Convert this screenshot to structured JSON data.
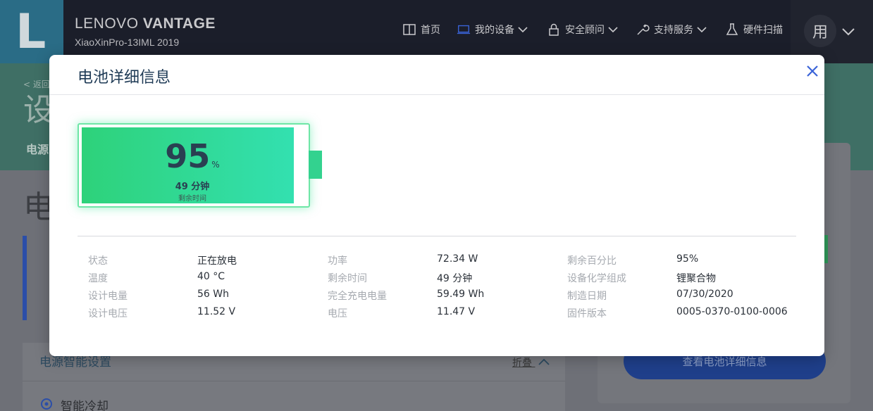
{
  "header": {
    "logo_letter": "L",
    "brand_light": "LENOVO",
    "brand_bold": "VANTAGE",
    "model": "XiaoXinPro-13IML 2019",
    "nav": [
      {
        "label": "首页",
        "icon": "book-icon"
      },
      {
        "label": "我的设备",
        "icon": "laptop-icon"
      },
      {
        "label": "安全顾问",
        "icon": "lock-icon"
      },
      {
        "label": "支持服务",
        "icon": "wrench-icon"
      },
      {
        "label": "硬件扫描",
        "icon": "flask-icon"
      }
    ],
    "avatar": "用"
  },
  "background": {
    "back_link": "< 返回",
    "hero_char": "设",
    "hero_tab": "电源",
    "section_char": "电",
    "left_card_title": "电源智能设置",
    "fold_label": "折叠",
    "cooling_label": "智能冷却",
    "view_details_button": "查看电池详细信息"
  },
  "modal": {
    "title": "电池详细信息",
    "battery": {
      "percent_value": "95",
      "percent_unit": "%",
      "fill_level": 95,
      "remaining_time": "49 分钟",
      "remaining_label": "剩余时间"
    },
    "specs": [
      [
        {
          "label": "状态",
          "value": "正在放电"
        },
        {
          "label": "功率",
          "value": "72.34 W"
        },
        {
          "label": "剩余百分比",
          "value": "95%"
        }
      ],
      [
        {
          "label": "温度",
          "value": "40 °C"
        },
        {
          "label": "剩余时间",
          "value": "49 分钟"
        },
        {
          "label": "设备化学组成",
          "value": "锂聚合物"
        }
      ],
      [
        {
          "label": "设计电量",
          "value": "56 Wh"
        },
        {
          "label": "完全充电电量",
          "value": "59.49 Wh"
        },
        {
          "label": "制造日期",
          "value": "07/30/2020"
        }
      ],
      [
        {
          "label": "设计电压",
          "value": "11.52 V"
        },
        {
          "label": "电压",
          "value": "11.47 V"
        },
        {
          "label": "固件版本",
          "value": "0005-0370-0100-0006"
        }
      ]
    ]
  },
  "colors": {
    "accent_blue": "#3a63d8",
    "battery_green": "#2ed27a",
    "battery_teal": "#33e0b0"
  }
}
